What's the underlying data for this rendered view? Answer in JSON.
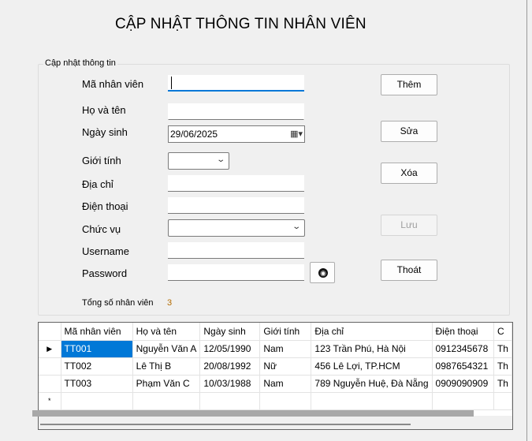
{
  "title": "CẬP NHẬT THÔNG TIN NHÂN VIÊN",
  "group": {
    "title": "Cập nhật thông tin",
    "labels": {
      "ma": "Mã nhân viên",
      "hoten": "Họ và tên",
      "ngaysinh": "Ngày sinh",
      "gioitinh": "Giới tính",
      "diachi": "Địa chỉ",
      "dienthoai": "Điện thoại",
      "chucvu": "Chức vụ",
      "username": "Username",
      "password": "Password"
    },
    "values": {
      "ma": "",
      "hoten": "",
      "ngaysinh": "29/06/2025",
      "gioitinh": "",
      "diachi": "",
      "dienthoai": "",
      "chucvu": "",
      "username": "",
      "password": ""
    },
    "count_label": "Tổng số nhân viên",
    "count_value": "3"
  },
  "buttons": {
    "them": "Thêm",
    "sua": "Sửa",
    "xoa": "Xóa",
    "luu": "Lưu",
    "thoat": "Thoát"
  },
  "grid": {
    "columns": [
      "Mã nhân viên",
      "Họ và tên",
      "Ngày sinh",
      "Giới tính",
      "Địa chỉ",
      "Điện thoại",
      "C"
    ],
    "rows": [
      [
        "TT001",
        "Nguyễn Văn A",
        "12/05/1990",
        "Nam",
        "123 Trần Phú, Hà Nội",
        "0912345678",
        "Th"
      ],
      [
        "TT002",
        "Lê Thị B",
        "20/08/1992",
        "Nữ",
        "456 Lê Lợi, TP.HCM",
        "0987654321",
        "Th"
      ],
      [
        "TT003",
        "Phạm Văn C",
        "10/03/1988",
        "Nam",
        "789 Nguyễn Huệ, Đà Nẵng",
        "0909090909",
        "Th"
      ]
    ],
    "current_row_marker": "▶",
    "new_row_marker": "*"
  },
  "icons": {
    "eye": "eye-icon",
    "calendar": "calendar-icon",
    "dropdown": "chevron-down-icon"
  },
  "colors": {
    "selection": "#0078d7",
    "count_value": "#b36b00"
  }
}
